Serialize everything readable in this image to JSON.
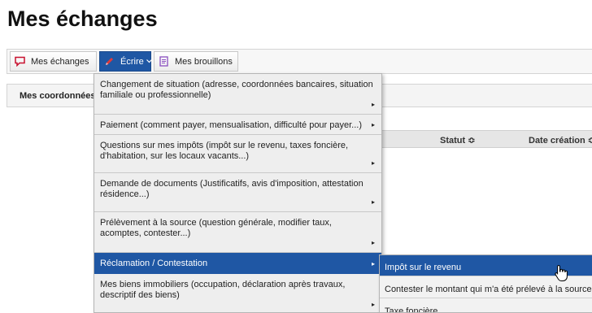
{
  "page": {
    "title": "Mes échanges"
  },
  "toolbar": {
    "echanges_label": "Mes échanges",
    "ecrire_label": "Écrire",
    "brouillons_label": "Mes brouillons"
  },
  "coords": {
    "label": "Mes coordonnées"
  },
  "table": {
    "statut": "Statut ≎",
    "date_creation": "Date création ≎"
  },
  "menu": {
    "items": [
      {
        "label": "Changement de situation (adresse, coordonnées bancaires, situation familiale ou professionnelle)"
      },
      {
        "label": "Paiement (comment payer, mensualisation, difficulté pour payer...)"
      },
      {
        "label": "Questions sur mes impôts (impôt sur le revenu, taxes foncière, d'habitation, sur les locaux vacants...)"
      },
      {
        "label": "Demande de documents (Justificatifs, avis d'imposition, attestation résidence...)"
      },
      {
        "label": "Prélèvement à la source (question générale, modifier taux, acomptes, contester...)"
      },
      {
        "label": "Réclamation / Contestation"
      },
      {
        "label": "Mes biens immobiliers (occupation, déclaration après travaux, descriptif des biens)"
      }
    ],
    "selected_index": 5
  },
  "submenu": {
    "items": [
      {
        "label": "Impôt sur le revenu"
      },
      {
        "label": "Contester le montant qui m'a été prélevé à la source"
      },
      {
        "label": "Taxe foncière"
      }
    ]
  },
  "colors": {
    "accent": "#1f57a4",
    "menu_bg": "#eeeeee",
    "icon_red": "#c8102e",
    "icon_purple": "#8a4fc0"
  },
  "icons": {
    "echanges": "chat-bubble-icon",
    "ecrire": "pencil-icon",
    "brouillons": "document-icon",
    "arrow": "chevron-right-icon",
    "dropdown": "chevron-down-icon",
    "cursor": "hand-pointer-icon"
  }
}
